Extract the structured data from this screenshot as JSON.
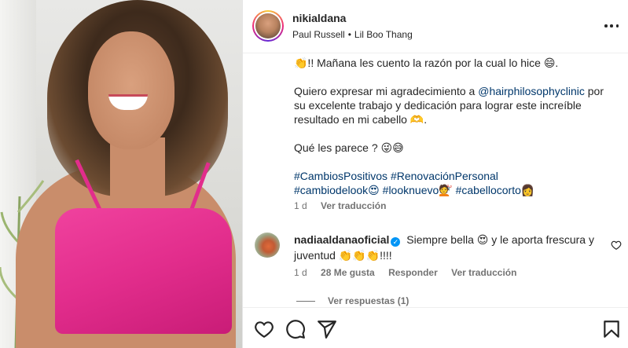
{
  "post": {
    "username": "nikialdana",
    "music_artist": "Paul Russell",
    "music_separator": "•",
    "music_track": "Lil Boo Thang"
  },
  "caption": {
    "line1": "👏!! Mañana les cuento la razón por la cual lo hice 😄.",
    "para2_prefix": "Quiero expresar mi agradecimiento a ",
    "para2_mention": "@hairphilosophyclinic",
    "para2_suffix": " por su excelente trabajo y dedicación para lograr este increíble resultado en mi cabello 🫶.",
    "para3": "Qué les parece ? 😜😅",
    "hashtags_line1": "#CambiosPositivos #RenovaciónPersonal",
    "hashtags_line2": "#cambiodelook😍 #looknuevo💇 #cabellocorto👩",
    "time": "1 d",
    "translate": "Ver traducción"
  },
  "comment": {
    "user": "nadiaaldanaoficial",
    "verified_glyph": "✓",
    "text": "Siempre bella 😍 y le aporta frescura y juventud 👏👏👏!!!!",
    "time": "1 d",
    "likes": "28 Me gusta",
    "reply": "Responder",
    "translate": "Ver traducción"
  },
  "replies": {
    "label": "Ver respuestas (1)"
  },
  "icons": {
    "more": "more-options-icon",
    "like": "heart-icon",
    "comment": "comment-icon",
    "share": "share-icon",
    "save": "bookmark-icon"
  },
  "colors": {
    "link": "#00376b",
    "verified": "#0095f6",
    "muted": "#737373",
    "top": "#e22d8c"
  }
}
